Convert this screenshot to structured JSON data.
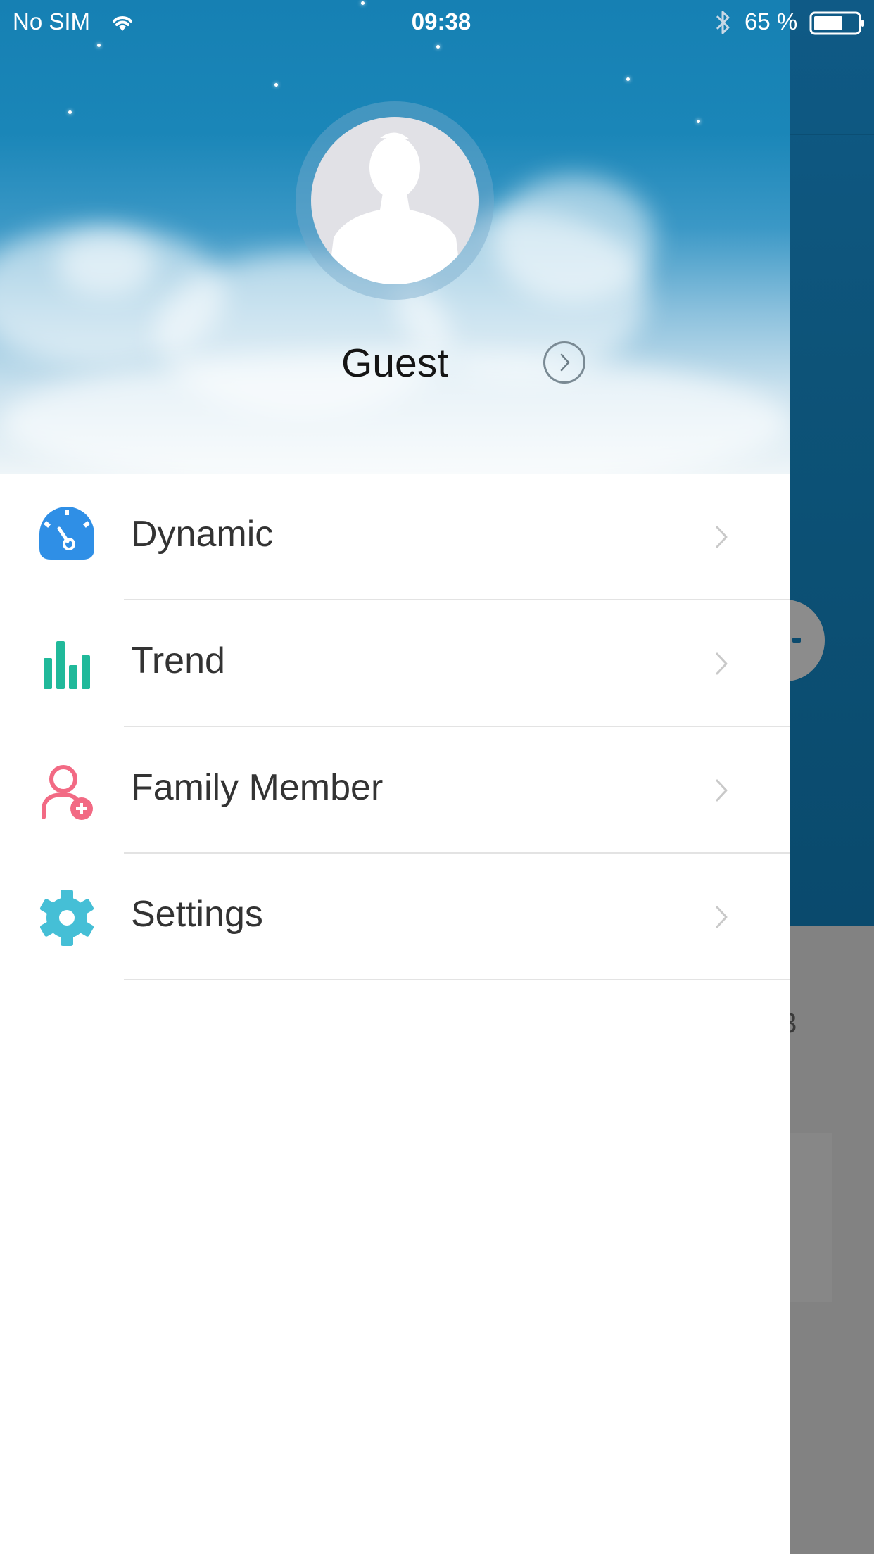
{
  "status_bar": {
    "carrier": "No SIM",
    "time": "09:38",
    "battery": "65 %"
  },
  "profile": {
    "name": "Guest"
  },
  "menu": [
    {
      "label": "Dynamic",
      "icon": "dashboard-gauge-icon",
      "color": "#2f8fe6"
    },
    {
      "label": "Trend",
      "icon": "bar-chart-icon",
      "color": "#20b99a"
    },
    {
      "label": "Family Member",
      "icon": "add-person-icon",
      "color": "#f26a84"
    },
    {
      "label": "Settings",
      "icon": "gear-icon",
      "color": "#45bfd6"
    }
  ],
  "background": {
    "partial_number": "3"
  },
  "colors": {
    "drawer_header_top": "#1680b3",
    "background_app": "#0d5378",
    "overlay_gray": "#828282"
  }
}
